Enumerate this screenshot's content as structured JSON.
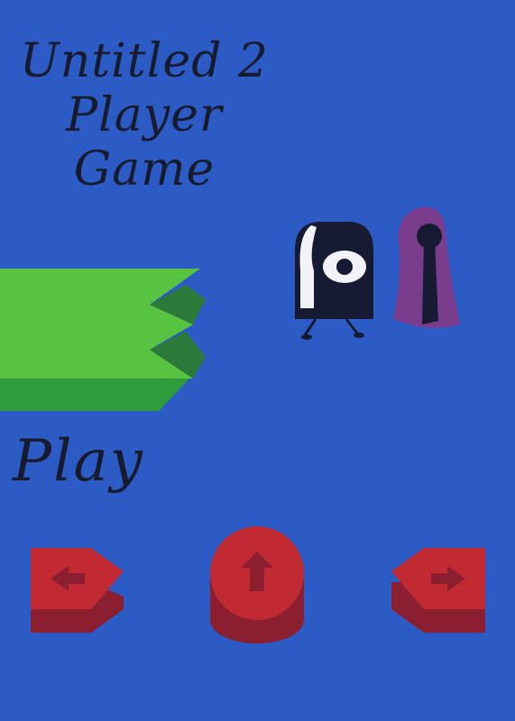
{
  "title": {
    "line1": "Untitled 2",
    "line2": "Player",
    "line3": "Game"
  },
  "menu": {
    "play_label": "Play"
  },
  "controls": {
    "left": "arrow-left-icon",
    "jump": "arrow-up-icon",
    "right": "arrow-right-icon"
  },
  "colors": {
    "background": "#2d5bc6",
    "platform_top": "#57c340",
    "platform_side": "#2f9c3c",
    "button_face": "#c12a32",
    "button_side": "#8b1f30",
    "player_one_body": "#161a33",
    "player_two_cloak": "#7a3d8e"
  }
}
